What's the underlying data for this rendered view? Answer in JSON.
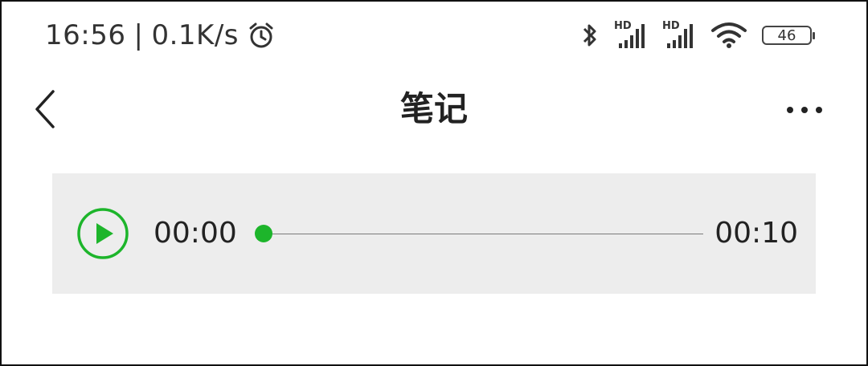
{
  "status_bar": {
    "time": "16:56",
    "separator": "|",
    "net_speed": "0.1K/s",
    "icons": [
      "alarm-icon",
      "bluetooth-icon",
      "hd-signal-icon",
      "hd-signal-icon",
      "wifi-icon",
      "battery-icon"
    ],
    "hd_label": "HD",
    "battery_level": "46"
  },
  "header": {
    "title": "笔记",
    "back_icon": "chevron-left-icon",
    "more_icon": "more-dots-icon"
  },
  "audio": {
    "current_time": "00:00",
    "duration": "00:10",
    "progress": 0,
    "accent_color": "#1db52b"
  }
}
